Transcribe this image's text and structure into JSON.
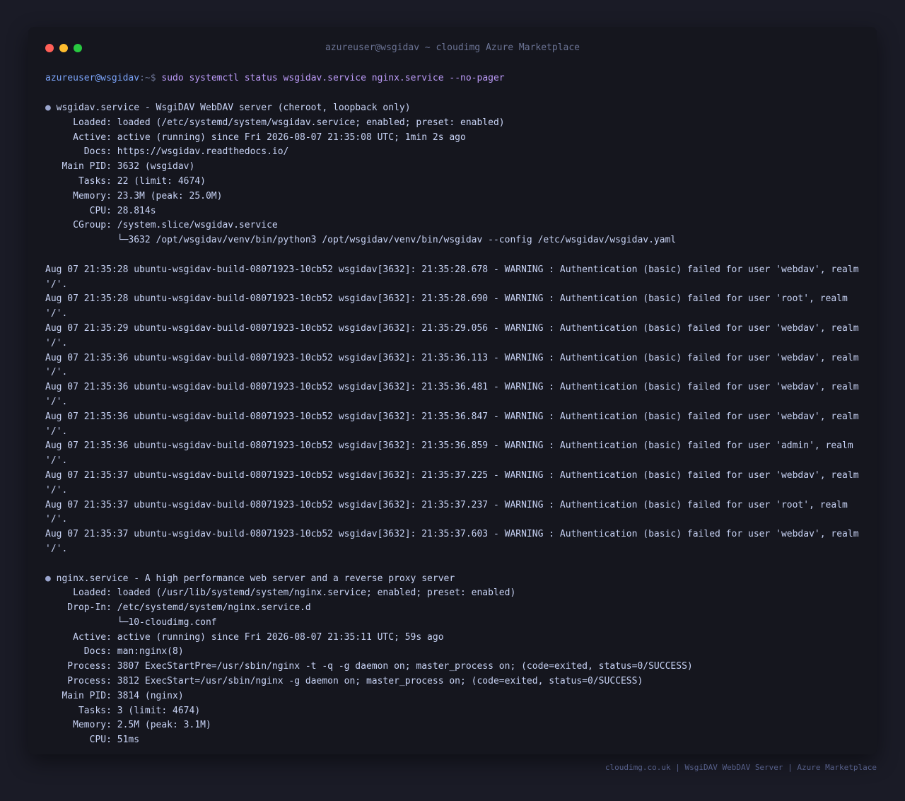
{
  "window": {
    "title": "azureuser@wsgidav ~ cloudimg Azure Marketplace"
  },
  "prompt": {
    "user_host": "azureuser@wsgidav",
    "path_symbol": ":~$ ",
    "command": "sudo systemctl status wsgidav.service nginx.service --no-pager"
  },
  "wsgidav": {
    "bullet": "●",
    "header": " wsgidav.service - WsgiDAV WebDAV server (cheroot, loopback only)",
    "lines": [
      "     Loaded: loaded (/etc/systemd/system/wsgidav.service; enabled; preset: enabled)",
      "     Active: active (running) since Fri 2026-08-07 21:35:08 UTC; 1min 2s ago",
      "       Docs: https://wsgidav.readthedocs.io/",
      "   Main PID: 3632 (wsgidav)",
      "      Tasks: 22 (limit: 4674)",
      "     Memory: 23.3M (peak: 25.0M)",
      "        CPU: 28.814s",
      "     CGroup: /system.slice/wsgidav.service",
      "             └─3632 /opt/wsgidav/venv/bin/python3 /opt/wsgidav/venv/bin/wsgidav --config /etc/wsgidav/wsgidav.yaml"
    ],
    "logs": [
      "Aug 07 21:35:28 ubuntu-wsgidav-build-08071923-10cb52 wsgidav[3632]: 21:35:28.678 - WARNING : Authentication (basic) failed for user 'webdav', realm",
      "'/'.",
      "Aug 07 21:35:28 ubuntu-wsgidav-build-08071923-10cb52 wsgidav[3632]: 21:35:28.690 - WARNING : Authentication (basic) failed for user 'root', realm",
      "'/'.",
      "Aug 07 21:35:29 ubuntu-wsgidav-build-08071923-10cb52 wsgidav[3632]: 21:35:29.056 - WARNING : Authentication (basic) failed for user 'webdav', realm",
      "'/'.",
      "Aug 07 21:35:36 ubuntu-wsgidav-build-08071923-10cb52 wsgidav[3632]: 21:35:36.113 - WARNING : Authentication (basic) failed for user 'webdav', realm",
      "'/'.",
      "Aug 07 21:35:36 ubuntu-wsgidav-build-08071923-10cb52 wsgidav[3632]: 21:35:36.481 - WARNING : Authentication (basic) failed for user 'webdav', realm",
      "'/'.",
      "Aug 07 21:35:36 ubuntu-wsgidav-build-08071923-10cb52 wsgidav[3632]: 21:35:36.847 - WARNING : Authentication (basic) failed for user 'webdav', realm",
      "'/'.",
      "Aug 07 21:35:36 ubuntu-wsgidav-build-08071923-10cb52 wsgidav[3632]: 21:35:36.859 - WARNING : Authentication (basic) failed for user 'admin', realm",
      "'/'.",
      "Aug 07 21:35:37 ubuntu-wsgidav-build-08071923-10cb52 wsgidav[3632]: 21:35:37.225 - WARNING : Authentication (basic) failed for user 'webdav', realm",
      "'/'.",
      "Aug 07 21:35:37 ubuntu-wsgidav-build-08071923-10cb52 wsgidav[3632]: 21:35:37.237 - WARNING : Authentication (basic) failed for user 'root', realm",
      "'/'.",
      "Aug 07 21:35:37 ubuntu-wsgidav-build-08071923-10cb52 wsgidav[3632]: 21:35:37.603 - WARNING : Authentication (basic) failed for user 'webdav', realm",
      "'/'."
    ]
  },
  "nginx": {
    "bullet": "●",
    "header": " nginx.service - A high performance web server and a reverse proxy server",
    "lines": [
      "     Loaded: loaded (/usr/lib/systemd/system/nginx.service; enabled; preset: enabled)",
      "    Drop-In: /etc/systemd/system/nginx.service.d",
      "             └─10-cloudimg.conf",
      "     Active: active (running) since Fri 2026-08-07 21:35:11 UTC; 59s ago",
      "       Docs: man:nginx(8)",
      "    Process: 3807 ExecStartPre=/usr/sbin/nginx -t -q -g daemon on; master_process on; (code=exited, status=0/SUCCESS)",
      "    Process: 3812 ExecStart=/usr/sbin/nginx -g daemon on; master_process on; (code=exited, status=0/SUCCESS)",
      "   Main PID: 3814 (nginx)",
      "      Tasks: 3 (limit: 4674)",
      "     Memory: 2.5M (peak: 3.1M)",
      "        CPU: 51ms"
    ]
  },
  "footer": {
    "text": "cloudimg.co.uk | WsgiDAV WebDAV Server | Azure Marketplace"
  },
  "colors": {
    "background": "#1a1b26",
    "terminal": "#15161e",
    "prompt_user": "#7aa2f7",
    "command": "#bb9af7",
    "text": "#c8d3f5"
  }
}
